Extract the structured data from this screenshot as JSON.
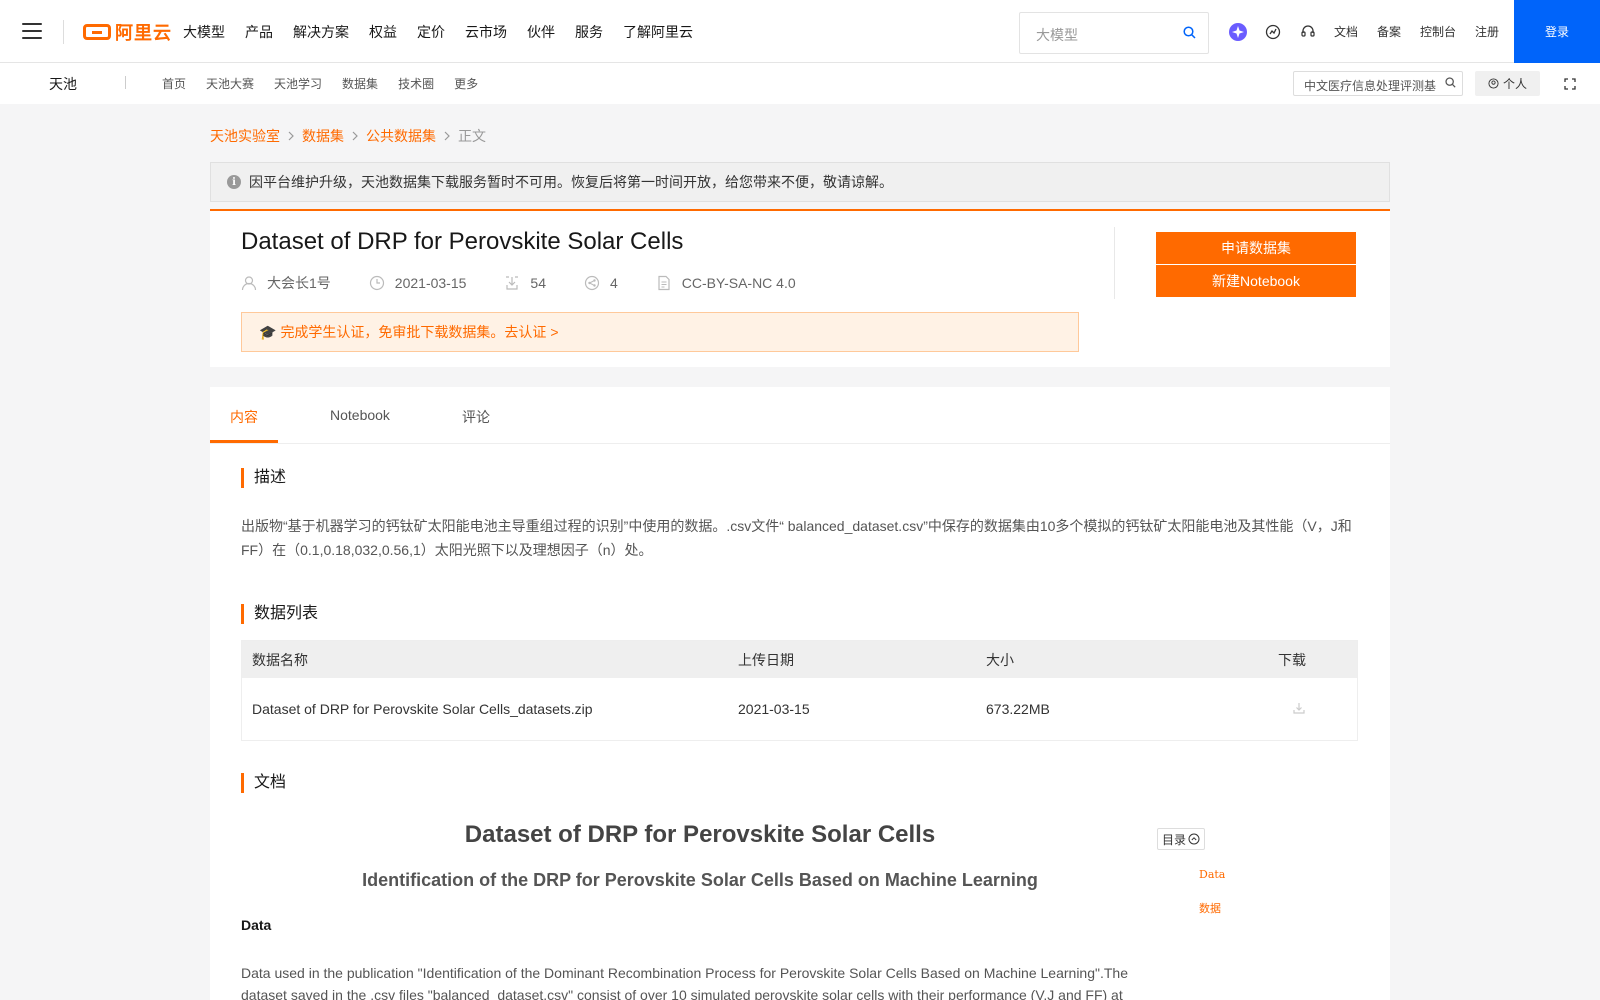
{
  "topnav": {
    "logo_text": "阿里云",
    "items": [
      "大模型",
      "产品",
      "解决方案",
      "权益",
      "定价",
      "云市场",
      "伙伴",
      "服务",
      "了解阿里云"
    ],
    "search_placeholder": "大模型",
    "links": [
      "文档",
      "备案",
      "控制台",
      "注册"
    ],
    "login": "登录"
  },
  "subnav": {
    "brand": "天池",
    "links": [
      "首页",
      "天池大赛",
      "天池学习",
      "数据集",
      "技术圈",
      "更多"
    ],
    "search_value": "中文医疗信息处理评测基",
    "personal": "个人"
  },
  "breadcrumb": [
    "天池实验室",
    "数据集",
    "公共数据集",
    "正文"
  ],
  "notice": "因平台维护升级，天池数据集下载服务暂时不可用。恢复后将第一时间开放，给您带来不便，敬请谅解。",
  "dataset": {
    "title": "Dataset of DRP for Perovskite Solar Cells",
    "author": "大会长1号",
    "date": "2021-03-15",
    "downloads": "54",
    "shares": "4",
    "license": "CC-BY-SA-NC 4.0",
    "student_cap": "🎓",
    "student_notice": "完成学生认证，免审批下载数据集。去认证 >",
    "apply_button": "申请数据集",
    "notebook_button": "新建Notebook"
  },
  "tabs": [
    "内容",
    "Notebook",
    "评论"
  ],
  "sections": {
    "description_title": "描述",
    "description": "出版物“基于机器学习的钙钛矿太阳能电池主导重组过程的识别”中使用的数据。.csv文件“ balanced_dataset.csv”中保存的数据集由10多个模拟的钙钛矿太阳能电池及其性能（V，J和FF）在（0.1,0.18,032,0.56,1）太阳光照下以及理想因子（n）处。",
    "datalist_title": "数据列表",
    "table_headers": [
      "数据名称",
      "上传日期",
      "大小",
      "下载"
    ],
    "table_rows": [
      {
        "name": "Dataset of DRP for Perovskite Solar Cells_datasets.zip",
        "date": "2021-03-15",
        "size": "673.22MB"
      }
    ],
    "docs_title": "文档"
  },
  "doc": {
    "title": "Dataset of DRP for Perovskite Solar Cells",
    "subtitle": "Identification of the DRP for Perovskite Solar Cells Based on Machine Learning",
    "heading": "Data",
    "paragraph": "Data used in the publication \"Identification of the Dominant Recombination Process for Perovskite Solar Cells Based on Machine Learning\".The dataset saved in the .csv files \"balanced_dataset.csv\" consist of over 10 simulated perovskite solar cells with their performance (V,J and FF) at",
    "toc_label": "目录",
    "toc_items": [
      "Data",
      "数据"
    ]
  },
  "colors": {
    "accent": "#ff6a00",
    "login_blue": "#0064fa"
  }
}
